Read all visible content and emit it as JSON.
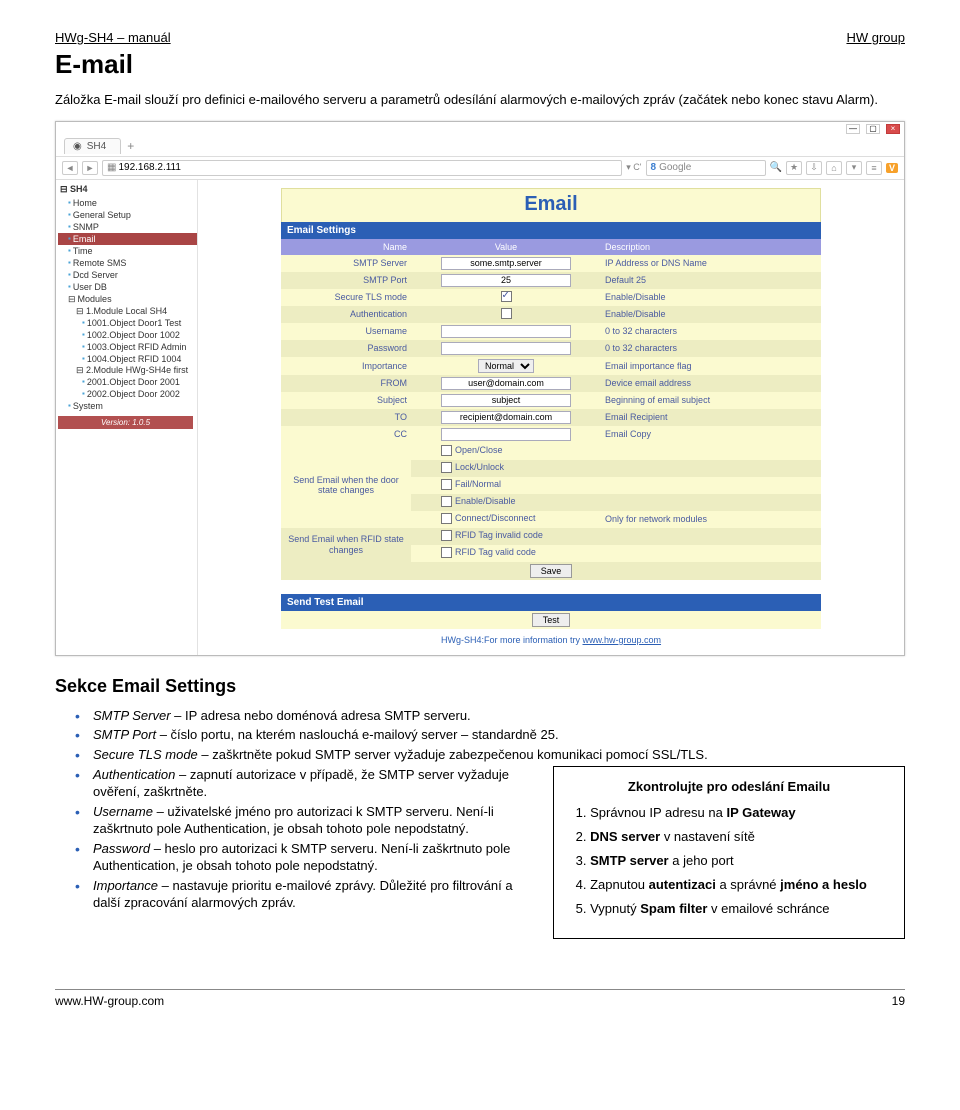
{
  "header": {
    "left": "HWg-SH4 – manuál",
    "right": "HW group"
  },
  "h1": "E-mail",
  "intro": "Záložka E-mail slouží pro definici e-mailového serveru a parametrů odesílání alarmových e-mailových zpráv (začátek nebo konec stavu Alarm).",
  "browser": {
    "tab": "SH4",
    "url": "192.168.2.111",
    "search_hint": "Google",
    "badge": "V"
  },
  "sidebar": {
    "root": "SH4",
    "items": [
      "Home",
      "General Setup",
      "SNMP",
      "Email",
      "Time",
      "Remote SMS",
      "Dcd Server",
      "User DB"
    ],
    "modules_label": "Modules",
    "mod1": {
      "label": "1.Module Local SH4",
      "children": [
        "1001.Object Door1 Test",
        "1002.Object Door 1002",
        "1003.Object RFID Admin",
        "1004.Object RFID 1004"
      ]
    },
    "mod2": {
      "label": "2.Module HWg-SH4e first",
      "children": [
        "2001.Object Door 2001",
        "2002.Object Door 2002"
      ]
    },
    "system": "System",
    "version": "Version: 1.0.5"
  },
  "page_title": "Email",
  "settings_header": "Email Settings",
  "cols": {
    "name": "Name",
    "value": "Value",
    "desc": "Description"
  },
  "rows": [
    {
      "name": "SMTP Server",
      "value": "some.smtp.server",
      "desc": "IP Address or DNS Name",
      "type": "text"
    },
    {
      "name": "SMTP Port",
      "value": "25",
      "desc": "Default 25",
      "type": "text"
    },
    {
      "name": "Secure TLS mode",
      "value": "checked",
      "desc": "Enable/Disable",
      "type": "check"
    },
    {
      "name": "Authentication",
      "value": "",
      "desc": "Enable/Disable",
      "type": "check"
    },
    {
      "name": "Username",
      "value": "",
      "desc": "0 to 32 characters",
      "type": "text"
    },
    {
      "name": "Password",
      "value": "",
      "desc": "0 to 32 characters",
      "type": "text"
    },
    {
      "name": "Importance",
      "value": "Normal",
      "desc": "Email importance flag",
      "type": "select"
    },
    {
      "name": "FROM",
      "value": "user@domain.com",
      "desc": "Device email address",
      "type": "text"
    },
    {
      "name": "Subject",
      "value": "subject",
      "desc": "Beginning of email subject",
      "type": "text"
    },
    {
      "name": "TO",
      "value": "recipient@domain.com",
      "desc": "Email Recipient",
      "type": "text"
    },
    {
      "name": "CC",
      "value": "",
      "desc": "Email Copy",
      "type": "text"
    }
  ],
  "door_group_label": "Send Email when the door state changes",
  "door_checks": [
    "Open/Close",
    "Lock/Unlock",
    "Fail/Normal",
    "Enable/Disable",
    "Connect/Disconnect"
  ],
  "door_desc": "Only for network modules",
  "rfid_group_label": "Send Email when RFID state changes",
  "rfid_checks": [
    "RFID Tag invalid code",
    "RFID Tag valid code"
  ],
  "save_label": "Save",
  "send_test_header": "Send Test Email",
  "test_label": "Test",
  "footer_info": "HWg-SH4:For more information try ",
  "footer_link": "www.hw-group.com",
  "h2": "Sekce Email Settings",
  "bullets": [
    {
      "term": "SMTP Server",
      "body": " – IP adresa nebo doménová adresa SMTP serveru."
    },
    {
      "term": "SMTP Port",
      "body": " – číslo portu, na kterém naslouchá e-mailový server – standardně 25."
    },
    {
      "term": "Secure TLS mode",
      "body": " – zaškrtněte pokud SMTP server vyžaduje zabezpečenou komunikaci pomocí SSL/TLS."
    },
    {
      "term": "Authentication",
      "body": " – zapnutí autorizace v případě, že SMTP server vyžaduje ověření, zaškrtněte."
    },
    {
      "term": "Username",
      "body": " – uživatelské jméno pro autorizaci k SMTP serveru. Není-li zaškrtnuto pole Authentication, je obsah tohoto pole nepodstatný."
    },
    {
      "term": "Password",
      "body": " – heslo pro autorizaci k SMTP serveru. Není-li zaškrtnuto pole Authentication, je obsah tohoto pole nepodstatný."
    },
    {
      "term": "Importance",
      "body": " – nastavuje prioritu e-mailové zprávy. Důležité pro filtrování a další zpracování alarmových zpráv."
    }
  ],
  "sidebox": {
    "title": "Zkontrolujte pro odeslání Emailu",
    "items": [
      "Správnou IP adresu na <b>IP Gateway</b>",
      "<b>DNS server</b> v nastavení sítě",
      "<b>SMTP server</b> a jeho port",
      "Zapnutou <b>autentizaci</b> a správné <b>jméno a heslo</b>",
      "Vypnutý <b>Spam filter</b> v emailové schránce"
    ]
  },
  "pgfoot": {
    "left": "www.HW-group.com",
    "right": "19"
  }
}
